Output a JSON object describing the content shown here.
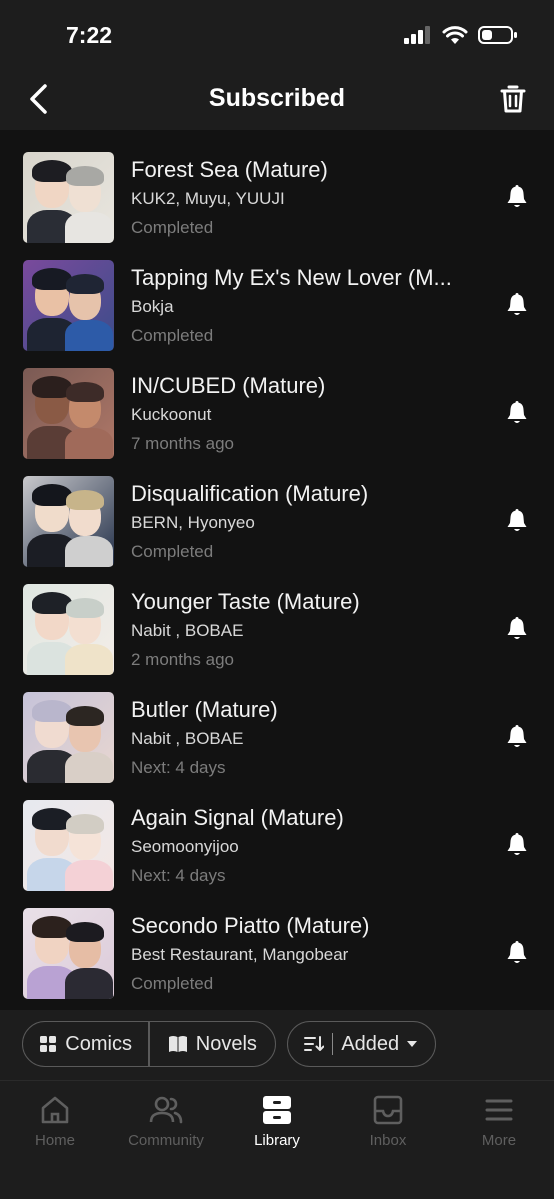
{
  "status_bar": {
    "time": "7:22"
  },
  "header": {
    "title": "Subscribed"
  },
  "items": [
    {
      "title": "Forest Sea (Mature)",
      "author": "KUK2, Muyu, YUUJI",
      "status": "Completed"
    },
    {
      "title": "Tapping My Ex's New Lover (M...",
      "author": "Bokja",
      "status": "Completed"
    },
    {
      "title": "IN/CUBED (Mature)",
      "author": "Kuckoonut",
      "status": "7 months ago"
    },
    {
      "title": "Disqualification (Mature)",
      "author": "BERN, Hyonyeo",
      "status": "Completed"
    },
    {
      "title": "Younger Taste (Mature)",
      "author": "Nabit , BOBAE",
      "status": "2 months ago"
    },
    {
      "title": "Butler (Mature)",
      "author": "Nabit , BOBAE",
      "status": "Next: 4 days"
    },
    {
      "title": "Again Signal (Mature)",
      "author": "Seomoonyijoo",
      "status": "Next: 4 days"
    },
    {
      "title": "Secondo Piatto (Mature)",
      "author": "Best Restaurant, Mangobear",
      "status": "Completed"
    }
  ],
  "filters": {
    "comics_label": "Comics",
    "novels_label": "Novels",
    "sort_label": "Added"
  },
  "tabs": [
    {
      "label": "Home",
      "icon": "home-icon",
      "active": false
    },
    {
      "label": "Community",
      "icon": "community-icon",
      "active": false
    },
    {
      "label": "Library",
      "icon": "library-icon",
      "active": true
    },
    {
      "label": "Inbox",
      "icon": "inbox-icon",
      "active": false
    },
    {
      "label": "More",
      "icon": "more-icon",
      "active": false
    }
  ],
  "colors": {
    "background": "#121212",
    "bar": "#1d1d1d",
    "muted_text": "#7c7c7c",
    "inactive_tab": "#5f5f5f"
  }
}
